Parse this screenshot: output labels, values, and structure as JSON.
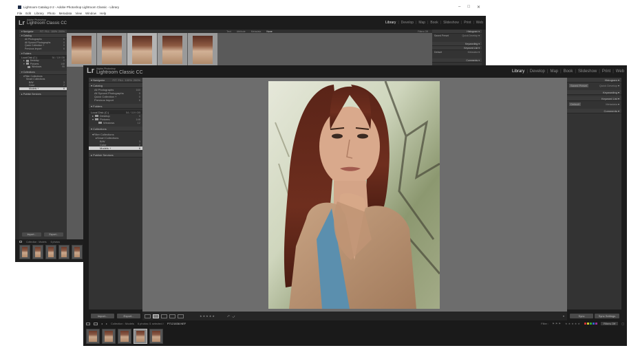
{
  "back_window": {
    "title": "Lightroom Catalog-2-2 - Adobe Photoshop Lightroom Classic - Library",
    "menu": [
      "File",
      "Edit",
      "Library",
      "Photo",
      "Metadata",
      "View",
      "Window",
      "Help"
    ],
    "window_controls": [
      "–",
      "□",
      "✕"
    ],
    "logo": "Lr",
    "brand_top": "Adobe Photoshop",
    "brand": "Lightroom Classic CC",
    "modules": [
      "Library",
      "Develop",
      "Map",
      "Book",
      "Slideshow",
      "Print",
      "Web"
    ],
    "left_panel": {
      "navigator": "Navigator",
      "nav_zoom": [
        "FIT",
        "FILL",
        "100%",
        "200%"
      ],
      "catalog": "Catalog",
      "catalog_items": [
        {
          "label": "All Photographs",
          "count": "6"
        },
        {
          "label": "All Synced Photographs",
          "count": "0"
        },
        {
          "label": "Quick Collection +",
          "count": "0"
        },
        {
          "label": "Previous Import",
          "count": "6"
        }
      ],
      "folders": "Folders",
      "volume": {
        "label": "Local Disk (C:)",
        "count": "54 / 119 GB"
      },
      "folder_items": [
        {
          "label": "Desktop",
          "count": "0"
        },
        {
          "label": "Pictures",
          "count": "148"
        },
        {
          "label": "Windows",
          "count": "95"
        }
      ],
      "collections": "Collections",
      "collection_set": "Filter Collections",
      "collection_items": [
        {
          "label": "Smart Collections",
          "count": ""
        },
        {
          "label": "B/W",
          "count": "3"
        },
        {
          "label": "Color",
          "count": "2"
        },
        {
          "label": "Models +",
          "count": "6"
        }
      ],
      "publish": "Publish Services",
      "import": "Import...",
      "export": "Export..."
    },
    "toolbar_tabs": [
      "Text",
      "Attribute",
      "Metadata",
      "None"
    ],
    "toolbar_right": "Filters Off",
    "right_panel": {
      "histogram": "Histogram",
      "quick_develop": "Quick Develop",
      "saved_preset": "Saved Preset",
      "keywording": "Keywording",
      "keyword_list": "Keyword List",
      "metadata": "Metadata",
      "default": "Default",
      "comments": "Comments"
    },
    "filmstrip_info": "Collection : Models",
    "filmstrip_count": "6 photos"
  },
  "front_window": {
    "logo": "Lr",
    "brand_top": "Adobe Photoshop",
    "brand": "Lightroom Classic CC",
    "modules": [
      "Library",
      "Develop",
      "Map",
      "Book",
      "Slideshow",
      "Print",
      "Web"
    ],
    "left_panel": {
      "navigator": "Navigator",
      "nav_zoom": [
        "FIT",
        "FILL",
        "100%",
        "200%"
      ],
      "catalog": "Catalog",
      "catalog_items": [
        {
          "label": "All Photographs",
          "count": "160"
        },
        {
          "label": "All Synced Photographs",
          "count": "0"
        },
        {
          "label": "Quick Collection +",
          "count": "0"
        },
        {
          "label": "Previous Import",
          "count": "6"
        }
      ],
      "folders": "Folders",
      "volume": {
        "label": "Local Disk (C:)",
        "count": "54 / 119 GB"
      },
      "folder_items": [
        {
          "label": "Desktop",
          "count": "0"
        },
        {
          "label": "Pictures",
          "count": "148"
        },
        {
          "label": "Windows",
          "count": "12"
        }
      ],
      "collections": "Collections",
      "collection_set": "Filter Collections",
      "collection_items": [
        {
          "label": "Smart Collections",
          "count": ""
        },
        {
          "label": "B/W",
          "count": "3"
        },
        {
          "label": "Color",
          "count": "2"
        },
        {
          "label": "Models +",
          "count": "6"
        }
      ],
      "publish": "Publish Services",
      "import": "Import...",
      "export": "Export..."
    },
    "right_panel": {
      "histogram": "Histogram",
      "quick_develop": "Quick Develop",
      "saved_preset": "Saved Preset",
      "keywording": "Keywording",
      "keyword_list": "Keyword List",
      "metadata": "Metadata",
      "default": "Default",
      "comments": "Comments",
      "sync": "Sync",
      "sync_settings": "Sync Settings"
    },
    "toolbar_stars": "★★★★★",
    "filmstrip_info": "Collection : Models",
    "filmstrip_detail": "6 photos /1 selected /",
    "filmstrip_file": "P7121838.NEF",
    "filter_label": "Filter :",
    "filter_value": "Filters Off"
  },
  "colors": {
    "lr_bg": "#1c1c1c",
    "panel_bg": "#333333",
    "center_bg": "#6d6d6d",
    "selection": "#d0d0d0"
  }
}
